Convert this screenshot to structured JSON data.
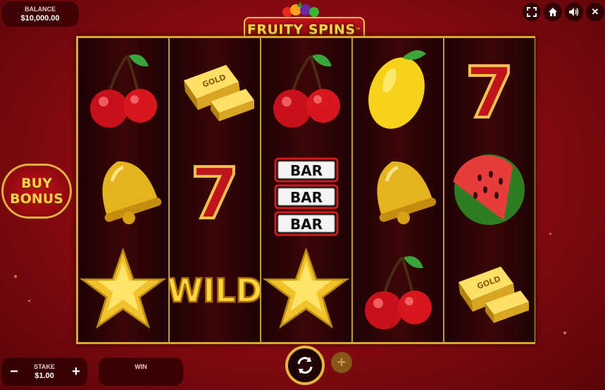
{
  "balance": {
    "label": "BALANCE",
    "value": "$10,000.00"
  },
  "logo": {
    "text": "FRUITY SPINS",
    "trademark": "™"
  },
  "buy_bonus": {
    "line1": "BUY",
    "line2": "BONUS"
  },
  "stake": {
    "label": "STAKE",
    "value": "$1.00",
    "minus": "−",
    "plus": "+"
  },
  "win": {
    "label": "WIN",
    "value": ""
  },
  "controls": {
    "close": "✕",
    "add": "+"
  },
  "reels": [
    [
      "cherry",
      "bell",
      "star"
    ],
    [
      "gold",
      "seven",
      "wild"
    ],
    [
      "cherry",
      "bar",
      "star"
    ],
    [
      "lemon",
      "bell",
      "cherry"
    ],
    [
      "seven",
      "watermelon",
      "gold"
    ]
  ],
  "symbol_text": {
    "gold": "GOLD",
    "bar": "BAR",
    "wild": "WILD",
    "seven": "7"
  },
  "colors": {
    "frame": "#d9a633",
    "accent_gold": "#ffd447",
    "background": "#8e0b12"
  }
}
